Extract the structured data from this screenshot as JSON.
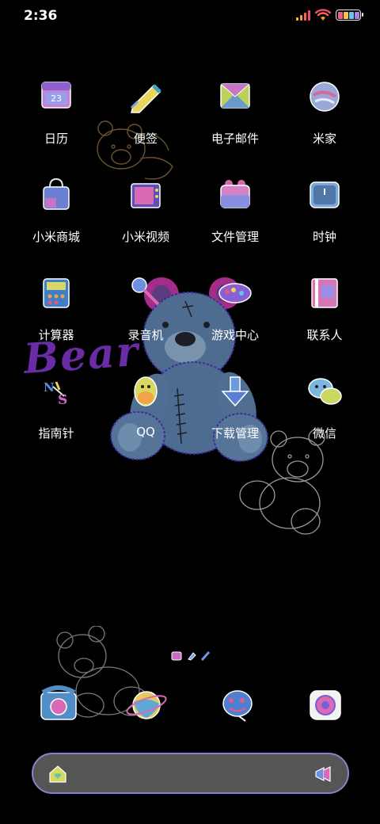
{
  "status_bar": {
    "time": "2:36",
    "signal_icon": "signal-bars-icon",
    "wifi_icon": "wifi-icon",
    "battery_icon": "battery-icon"
  },
  "wallpaper": {
    "bear_text": "Bear",
    "n_s_text": "N S"
  },
  "apps": [
    {
      "label": "日历",
      "icon": "calendar-icon",
      "badge": "23"
    },
    {
      "label": "便签",
      "icon": "notes-pen-icon"
    },
    {
      "label": "电子邮件",
      "icon": "email-envelope-icon"
    },
    {
      "label": "米家",
      "icon": "mijia-ball-icon"
    },
    {
      "label": "小米商城",
      "icon": "shopping-bag-icon"
    },
    {
      "label": "小米视频",
      "icon": "tv-icon"
    },
    {
      "label": "文件管理",
      "icon": "folder-icon"
    },
    {
      "label": "时钟",
      "icon": "clock-icon"
    },
    {
      "label": "计算器",
      "icon": "calculator-icon"
    },
    {
      "label": "录音机",
      "icon": "microphone-icon"
    },
    {
      "label": "游戏中心",
      "icon": "game-controller-icon"
    },
    {
      "label": "联系人",
      "icon": "contacts-book-icon"
    },
    {
      "label": "指南针",
      "icon": "compass-icon"
    },
    {
      "label": "QQ",
      "icon": "qq-penguin-icon"
    },
    {
      "label": "下载管理",
      "icon": "download-arrow-icon"
    },
    {
      "label": "微信",
      "icon": "wechat-bubbles-icon"
    }
  ],
  "dock": [
    {
      "icon": "phone-icon"
    },
    {
      "icon": "browser-planet-icon"
    },
    {
      "icon": "messages-icon"
    },
    {
      "icon": "camera-icon"
    }
  ],
  "search_bar": {
    "left_icon": "home-heart-icon",
    "right_icon": "megaphone-icon"
  },
  "colors": {
    "background": "#000000",
    "search_bar_bg": "#555556",
    "search_bar_border": "#8d7fc9",
    "bear_text": "#6a2ca5"
  }
}
